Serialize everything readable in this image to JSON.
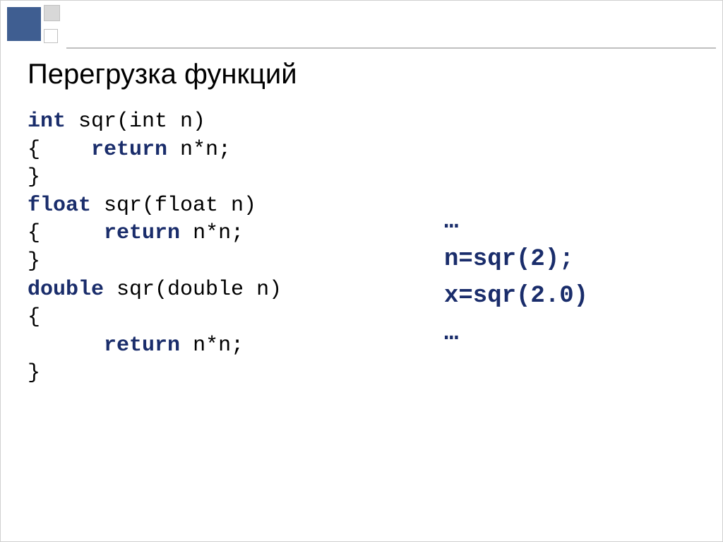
{
  "title": "Перегрузка функций",
  "left": {
    "l1_kw": "int",
    "l1_rest": " sqr(int n)",
    "l2_open": "{    ",
    "l2_kw": "return",
    "l2_rest": " n*n;",
    "l3": "}",
    "l4": "",
    "l5_kw": "float",
    "l5_rest": " sqr(float n)",
    "l6_open": "{     ",
    "l6_kw": "return",
    "l6_rest": " n*n;",
    "l7": "}",
    "l8": "",
    "l9_kw": "double",
    "l9_rest": " sqr(double n)",
    "l10": "{",
    "l11_indent": "      ",
    "l11_kw": "return",
    "l11_rest": " n*n;",
    "l12": "}"
  },
  "right": {
    "r1": "…",
    "r2": "n=sqr(2);",
    "r3": "x=sqr(2.0)",
    "r4": "…"
  }
}
